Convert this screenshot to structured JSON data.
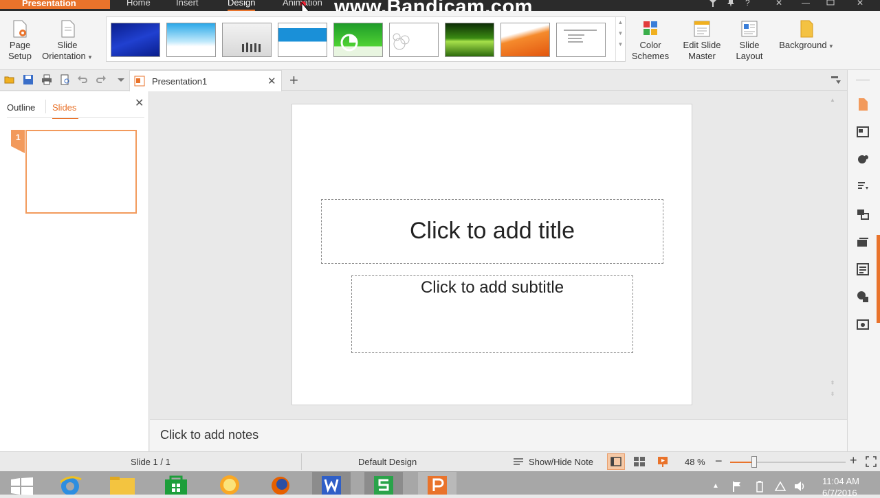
{
  "titlebar": {
    "app_name": "Presentation",
    "tabs": [
      "Home",
      "Insert",
      "Design",
      "Animation"
    ],
    "watermark": "www.Bandicam.com",
    "controls": [
      "?",
      "—",
      "✕"
    ]
  },
  "ribbon": {
    "page_setup": "Page Setup",
    "slide_orientation": "Slide Orientation",
    "color_schemes": "Color Schemes",
    "edit_slide_master": "Edit Slide Master",
    "slide_layout": "Slide Layout",
    "background": "Background",
    "icons": [
      "page-setup-icon",
      "slide-orientation-icon",
      "color-schemes-icon",
      "edit-slide-master-icon",
      "slide-layout-icon",
      "background-icon"
    ]
  },
  "doc_tab": {
    "title": "Presentation1",
    "close": "✕",
    "new_tab": "+"
  },
  "left_panel": {
    "tabs": [
      "Outline",
      "Slides"
    ],
    "active_tab": "Slides",
    "close": "✕",
    "slide_number": "1"
  },
  "slide": {
    "title_placeholder": "Click to add title",
    "subtitle_placeholder": "Click to add subtitle"
  },
  "notes": {
    "placeholder": "Click to add notes"
  },
  "status": {
    "slide_counter": "Slide 1 / 1",
    "design_name": "Default Design",
    "show_hide_note": "Show/Hide Note",
    "zoom": "48 %",
    "zoom_fraction": 0.48
  },
  "taskbar": {
    "time": "11:04 AM",
    "date": "6/7/2016"
  },
  "colors": {
    "accent": "#e9732b",
    "titlebar": "#2b2b2b",
    "taskbar": "#a7a7a7"
  }
}
